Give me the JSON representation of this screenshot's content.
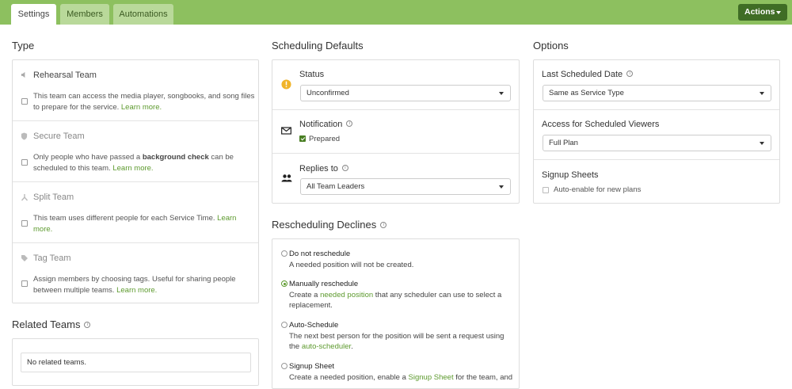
{
  "tabs": [
    {
      "label": "Settings",
      "active": true
    },
    {
      "label": "Members",
      "active": false
    },
    {
      "label": "Automations",
      "active": false
    }
  ],
  "actions_label": "Actions",
  "type_section": {
    "heading": "Type",
    "items": [
      {
        "title": "Rehearsal Team",
        "icon": "speaker-icon",
        "desc": "This team can access the media player, songbooks, and song files to prepare for the service.",
        "link": "Learn more."
      },
      {
        "title": "Secure Team",
        "icon": "shield-icon",
        "desc_pre": "Only people who have passed a ",
        "desc_bold": "background check",
        "desc_post": " can be scheduled to this team.",
        "link": "Learn more."
      },
      {
        "title": "Split Team",
        "icon": "split-icon",
        "desc": "This team uses different people for each Service Time.",
        "link": "Learn more."
      },
      {
        "title": "Tag Team",
        "icon": "tag-icon",
        "desc": "Assign members by choosing tags. Useful for sharing people between multiple teams.",
        "link": "Learn more."
      }
    ]
  },
  "related_teams": {
    "heading": "Related Teams",
    "empty_text": "No related teams."
  },
  "scheduling_defaults": {
    "heading": "Scheduling Defaults",
    "status_label": "Status",
    "status_value": "Unconfirmed",
    "notification_label": "Notification",
    "notification_value": "Prepared",
    "replies_label": "Replies to",
    "replies_value": "All Team Leaders"
  },
  "rescheduling": {
    "heading": "Rescheduling Declines",
    "options": [
      {
        "title": "Do not reschedule",
        "desc": "A needed position will not be created.",
        "selected": false
      },
      {
        "title": "Manually reschedule",
        "desc_pre": "Create a ",
        "link": "needed position",
        "desc_post": " that any scheduler can use to select a replacement.",
        "selected": true
      },
      {
        "title": "Auto-Schedule",
        "desc_pre": "The next best person for the position will be sent a request using the ",
        "link": "auto-scheduler",
        "desc_post": ".",
        "selected": false
      },
      {
        "title": "Signup Sheet",
        "desc_pre": "Create a needed position, enable a ",
        "link": "Signup Sheet",
        "desc_post": " for the team, and",
        "selected": false
      }
    ]
  },
  "options": {
    "heading": "Options",
    "last_scheduled_label": "Last Scheduled Date",
    "last_scheduled_value": "Same as Service Type",
    "access_label": "Access for Scheduled Viewers",
    "access_value": "Full Plan",
    "signup_label": "Signup Sheets",
    "signup_checkbox": "Auto-enable for new plans"
  },
  "colors": {
    "accent": "#8dc05f",
    "dark_accent": "#3f6d25",
    "link": "#5d9a2e",
    "warning": "#f0b429"
  }
}
